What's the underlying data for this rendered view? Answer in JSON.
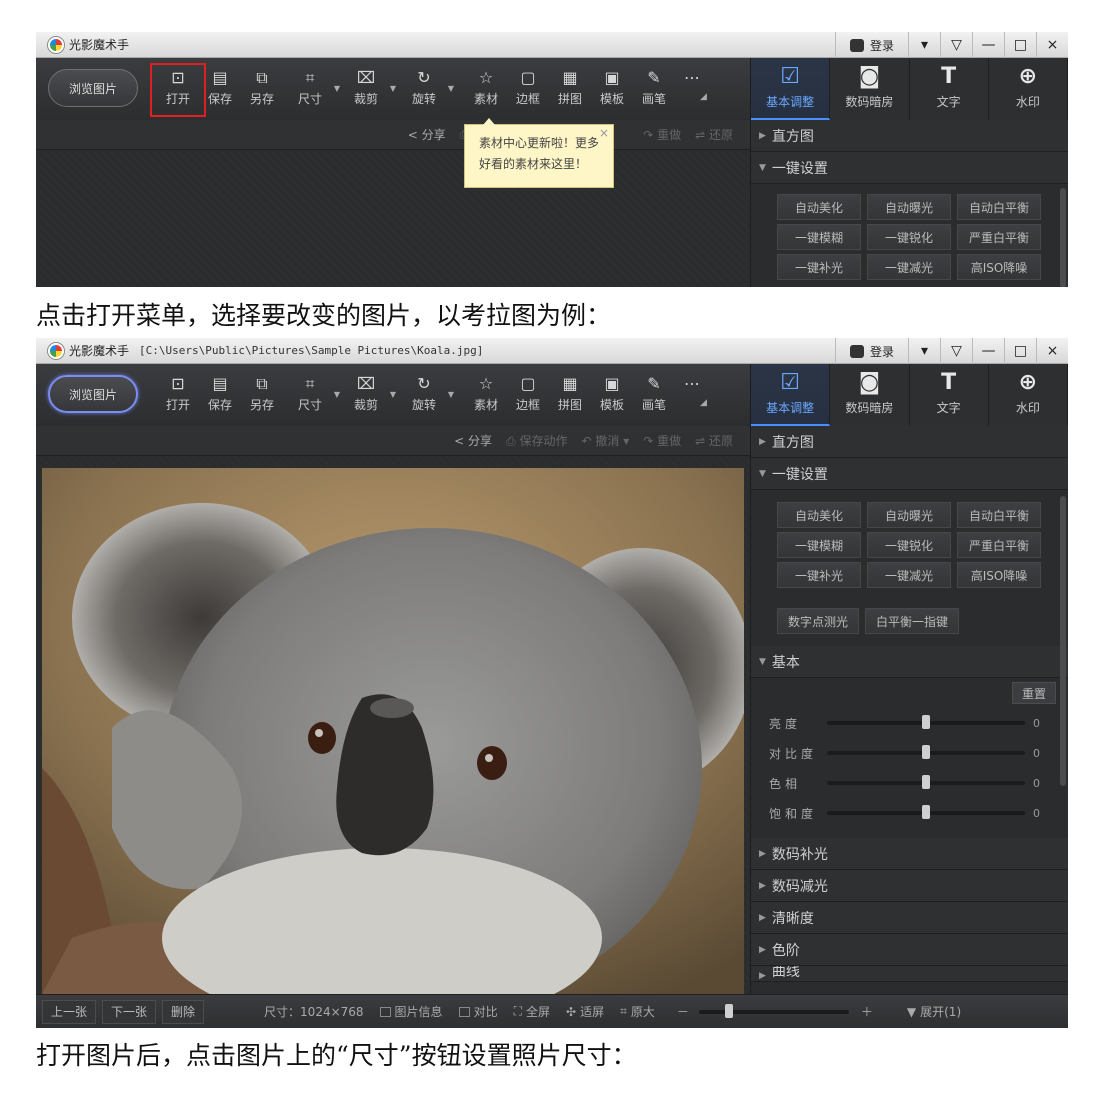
{
  "app": {
    "title": "光影魔术手",
    "path": "[C:\\Users\\Public\\Pictures\\Sample Pictures\\Koala.jpg]",
    "login": "登录"
  },
  "window_controls": [
    "▾",
    "▽",
    "—",
    "□",
    "×"
  ],
  "toolbar": {
    "browse": "浏览图片",
    "tools": [
      {
        "label": "打开",
        "icon": "open-image-icon"
      },
      {
        "label": "保存",
        "icon": "save-icon"
      },
      {
        "label": "另存",
        "icon": "save-as-icon"
      },
      {
        "label": "尺寸",
        "icon": "resize-icon"
      },
      {
        "label": "裁剪",
        "icon": "crop-icon"
      },
      {
        "label": "旋转",
        "icon": "rotate-icon"
      },
      {
        "label": "素材",
        "icon": "material-icon"
      },
      {
        "label": "边框",
        "icon": "border-icon"
      },
      {
        "label": "拼图",
        "icon": "collage-icon"
      },
      {
        "label": "模板",
        "icon": "template-icon"
      },
      {
        "label": "画笔",
        "icon": "brush-icon"
      },
      {
        "label": "",
        "icon": "more-icon"
      }
    ]
  },
  "right_tabs": [
    {
      "label": "基本调整",
      "icon": "basic-adjust-icon",
      "active": true
    },
    {
      "label": "数码暗房",
      "icon": "darkroom-icon",
      "active": false
    },
    {
      "label": "文字",
      "icon": "text-icon",
      "active": false
    },
    {
      "label": "水印",
      "icon": "watermark-icon",
      "active": false
    }
  ],
  "subbar": {
    "share": "分享",
    "save_action": "保存动作",
    "undo": "撤消",
    "redo": "重做",
    "restore": "还原"
  },
  "tooltip": {
    "line1": "素材中心更新啦！更多",
    "line2": "好看的素材来这里！"
  },
  "panel": {
    "histogram": "直方图",
    "one_click": "一键设置",
    "one_click_buttons": [
      "自动美化",
      "自动曝光",
      "自动白平衡",
      "一键模糊",
      "一键锐化",
      "严重白平衡",
      "一键补光",
      "一键减光",
      "高ISO降噪"
    ],
    "extra_buttons": [
      "数字点测光",
      "白平衡一指键"
    ],
    "basic": "基本",
    "reset": "重置",
    "sliders": [
      {
        "label": "亮度",
        "value": "0",
        "level": 0.5
      },
      {
        "label": "对比度",
        "value": "0",
        "level": 0.5
      },
      {
        "label": "色相",
        "value": "0",
        "level": 0.5
      },
      {
        "label": "饱和度",
        "value": "0",
        "level": 0.5
      }
    ],
    "sections": [
      "数码补光",
      "数码减光",
      "清晰度",
      "色阶",
      "曲线"
    ]
  },
  "statusbar": {
    "prev": "上一张",
    "next": "下一张",
    "delete": "删除",
    "size": "尺寸：1024×768",
    "info": "图片信息",
    "compare": "对比",
    "fullscreen": "全屏",
    "fit": "适屏",
    "original": "原大",
    "minus": "－",
    "plus": "＋",
    "expand": "展开(1)",
    "zoom_level": 0.2
  },
  "captions": {
    "first": "点击打开菜单，选择要改变的图片，以考拉图为例：",
    "second": "打开图片后，点击图片上的“尺寸”按钮设置照片尺寸："
  }
}
